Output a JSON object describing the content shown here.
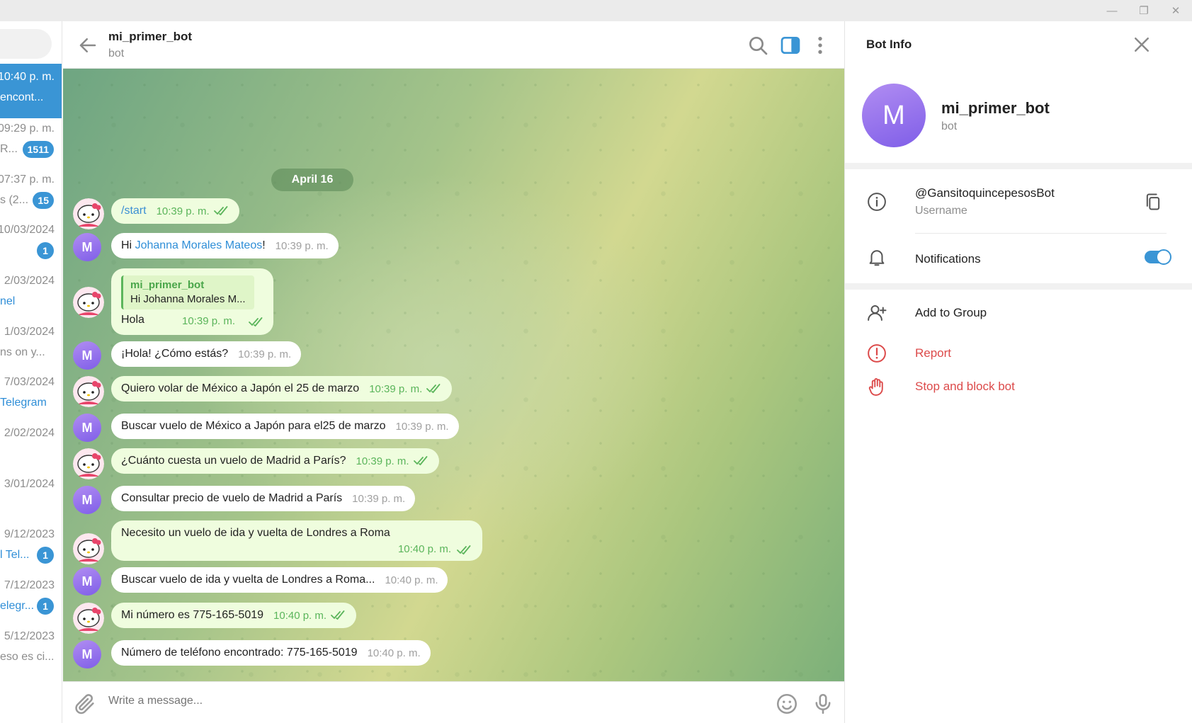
{
  "window": {
    "minimize_glyph": "—",
    "maximize_glyph": "❐",
    "close_glyph": "✕"
  },
  "chat_list": {
    "items": [
      {
        "time": "10:40 p. m.",
        "preview": "encont...",
        "badge": "",
        "active": true,
        "preview_link": false
      },
      {
        "time": "09:29 p. m.",
        "preview": "R...",
        "badge": "1511",
        "active": false,
        "preview_link": false
      },
      {
        "time": "07:37 p. m.",
        "preview": "s (2...",
        "badge": "15",
        "active": false,
        "preview_link": false
      },
      {
        "time": "10/03/2024",
        "preview": "",
        "badge": "1",
        "active": false,
        "preview_link": false
      },
      {
        "time": "2/03/2024",
        "preview": "nel",
        "badge": "",
        "active": false,
        "preview_link": true
      },
      {
        "time": "1/03/2024",
        "preview": "ns on y...",
        "badge": "",
        "active": false,
        "preview_link": false
      },
      {
        "time": "7/03/2024",
        "preview": "Telegram",
        "badge": "",
        "active": false,
        "preview_link": true
      },
      {
        "time": "2/02/2024",
        "preview": "",
        "badge": "",
        "active": false,
        "preview_link": false
      },
      {
        "time": "3/01/2024",
        "preview": "",
        "badge": "",
        "active": false,
        "preview_link": false
      },
      {
        "time": "9/12/2023",
        "preview": "l Tel...",
        "badge": "1",
        "active": false,
        "preview_link": true
      },
      {
        "time": "7/12/2023",
        "preview": "elegr...",
        "badge": "1",
        "active": false,
        "preview_link": true
      },
      {
        "time": "5/12/2023",
        "preview": "eso es ci...",
        "badge": "",
        "active": false,
        "preview_link": false
      }
    ]
  },
  "header": {
    "title": "mi_primer_bot",
    "subtitle": "bot"
  },
  "chat": {
    "date_label": "April 16",
    "avatar_letter": "M",
    "messages": [
      {
        "text": "/start",
        "time": "10:39 p. m."
      },
      {
        "pre": "Hi ",
        "link": "Johanna Morales Mateos",
        "post": "!",
        "time": "10:39 p. m."
      },
      {
        "quote_name": "mi_primer_bot",
        "quote_text": "Hi Johanna Morales M...",
        "text": "Hola",
        "time": "10:39 p. m."
      },
      {
        "text": "¡Hola! ¿Cómo estás?",
        "time": "10:39 p. m."
      },
      {
        "text": "Quiero volar de México a Japón el 25 de marzo",
        "time": "10:39 p. m."
      },
      {
        "text": "Buscar vuelo de México a Japón para el25 de marzo",
        "time": "10:39 p. m."
      },
      {
        "text": "¿Cuánto cuesta un vuelo de Madrid a París?",
        "time": "10:39 p. m."
      },
      {
        "text": "Consultar precio de vuelo de Madrid a París",
        "time": "10:39 p. m."
      },
      {
        "text": "Necesito un vuelo de ida y vuelta de Londres a Roma",
        "time": "10:40 p. m."
      },
      {
        "text": "Buscar vuelo de ida y vuelta de Londres a Roma...",
        "time": "10:40 p. m."
      },
      {
        "text": "Mi número es 775-165-5019",
        "time": "10:40 p. m."
      },
      {
        "text": "Número de teléfono encontrado: 775-165-5019",
        "time": "10:40 p. m."
      }
    ]
  },
  "input": {
    "placeholder": "Write a message..."
  },
  "info_panel": {
    "title": "Bot Info",
    "avatar_letter": "M",
    "name": "mi_primer_bot",
    "subtitle": "bot",
    "username": "@GansitoquincepesosBot",
    "username_hint": "Username",
    "notifications_label": "Notifications",
    "notifications_on": true,
    "add_to_group": "Add to Group",
    "report": "Report",
    "stop_block": "Stop and block bot"
  },
  "colors": {
    "accent": "#3a95d5",
    "outgoing_bubble": "#effdde",
    "danger": "#dc4a4a",
    "bot_avatar": "#8e6cec"
  }
}
